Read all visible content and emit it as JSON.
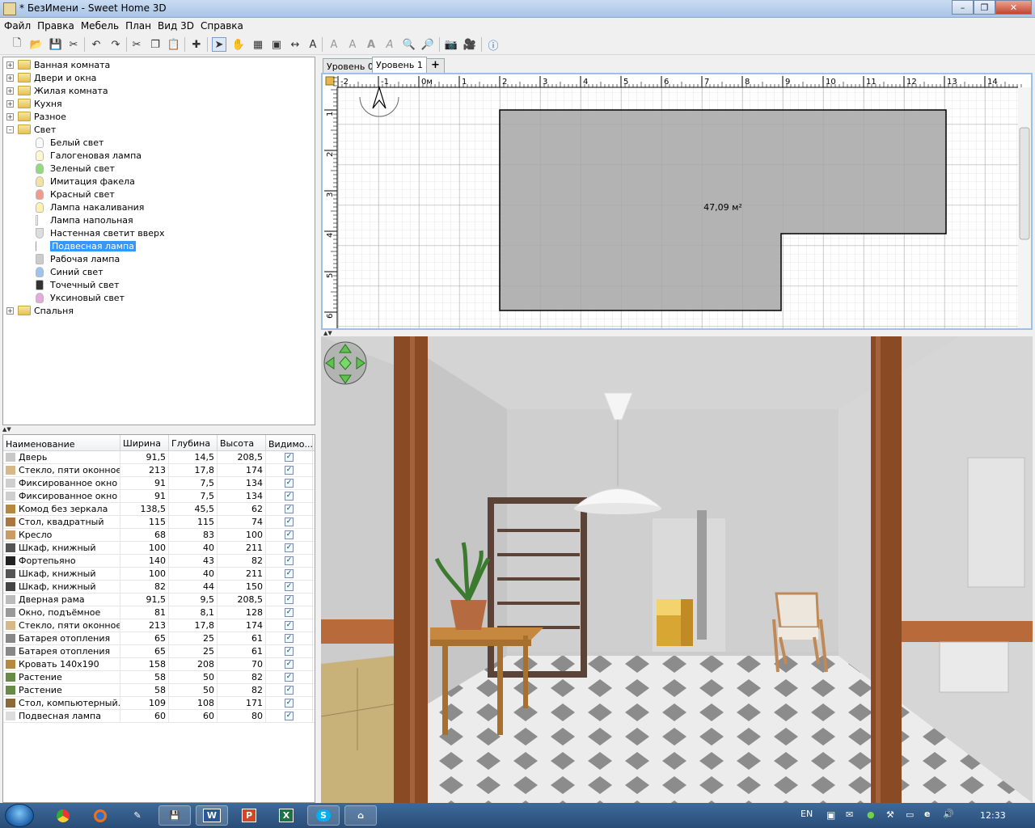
{
  "window": {
    "title": "* БезИмени - Sweet Home 3D"
  },
  "menu": [
    "Файл",
    "Правка",
    "Мебель",
    "План",
    "Вид 3D",
    "Справка"
  ],
  "toolbar": {
    "icons": [
      "new-file-icon",
      "open-folder-icon",
      "save-icon",
      "cut-scissors-icon",
      "undo-icon",
      "redo-icon",
      "cut-icon",
      "copy-icon",
      "paste-icon",
      "add-furniture-icon",
      "select-arrow-icon",
      "pan-hand-icon",
      "create-walls-icon",
      "create-rooms-icon",
      "create-dimensions-icon",
      "add-text-icon",
      "increase-text-icon",
      "decrease-text-icon",
      "bold-text-icon",
      "italic-text-icon",
      "zoom-in-icon",
      "zoom-out-icon",
      "create-photo-icon",
      "create-video-icon",
      "help-icon"
    ]
  },
  "catalog": {
    "categories": [
      {
        "label": "Ванная комната",
        "expanded": false
      },
      {
        "label": "Двери и окна",
        "expanded": false
      },
      {
        "label": "Жилая комната",
        "expanded": false
      },
      {
        "label": "Кухня",
        "expanded": false
      },
      {
        "label": "Разное",
        "expanded": false
      },
      {
        "label": "Свет",
        "expanded": true
      },
      {
        "label": "Спальня",
        "expanded": false
      }
    ],
    "light_items": [
      "Белый свет",
      "Галогеновая лампа",
      "Зеленый свет",
      "Имитация факела",
      "Красный свет",
      "Лампа накаливания",
      "Лампа напольная",
      "Настенная светит вверх",
      "Подвесная лампа",
      "Рабочая лампа",
      "Синий свет",
      "Точечный свет",
      "Уксиновый свет"
    ],
    "selected": "Подвесная лампа"
  },
  "furniture": {
    "columns": [
      "Наименование",
      "Ширина",
      "Глубина",
      "Высота",
      "Видимо..."
    ],
    "rows": [
      {
        "name": "Дверь",
        "w": "91,5",
        "d": "14,5",
        "h": "208,5",
        "visible": true
      },
      {
        "name": "Стекло, пяти оконное",
        "w": "213",
        "d": "17,8",
        "h": "174",
        "visible": true
      },
      {
        "name": "Фиксированное окно",
        "w": "91",
        "d": "7,5",
        "h": "134",
        "visible": true
      },
      {
        "name": "Фиксированное окно",
        "w": "91",
        "d": "7,5",
        "h": "134",
        "visible": true
      },
      {
        "name": "Комод без зеркала",
        "w": "138,5",
        "d": "45,5",
        "h": "62",
        "visible": true
      },
      {
        "name": "Стол, квадратный",
        "w": "115",
        "d": "115",
        "h": "74",
        "visible": true
      },
      {
        "name": "Кресло",
        "w": "68",
        "d": "83",
        "h": "100",
        "visible": true
      },
      {
        "name": "Шкаф, книжный",
        "w": "100",
        "d": "40",
        "h": "211",
        "visible": true
      },
      {
        "name": "Фортепьяно",
        "w": "140",
        "d": "43",
        "h": "82",
        "visible": true
      },
      {
        "name": "Шкаф, книжный",
        "w": "100",
        "d": "40",
        "h": "211",
        "visible": true
      },
      {
        "name": "Шкаф, книжный",
        "w": "82",
        "d": "44",
        "h": "150",
        "visible": true
      },
      {
        "name": "Дверная рама",
        "w": "91,5",
        "d": "9,5",
        "h": "208,5",
        "visible": true
      },
      {
        "name": "Окно, подъёмное",
        "w": "81",
        "d": "8,1",
        "h": "128",
        "visible": true
      },
      {
        "name": "Стекло, пяти оконное",
        "w": "213",
        "d": "17,8",
        "h": "174",
        "visible": true
      },
      {
        "name": "Батарея отопления",
        "w": "65",
        "d": "25",
        "h": "61",
        "visible": true
      },
      {
        "name": "Батарея отопления",
        "w": "65",
        "d": "25",
        "h": "61",
        "visible": true
      },
      {
        "name": "Кровать 140x190",
        "w": "158",
        "d": "208",
        "h": "70",
        "visible": true
      },
      {
        "name": "Растение",
        "w": "58",
        "d": "50",
        "h": "82",
        "visible": true
      },
      {
        "name": "Растение",
        "w": "58",
        "d": "50",
        "h": "82",
        "visible": true
      },
      {
        "name": "Стол, компьютерный...",
        "w": "109",
        "d": "108",
        "h": "171",
        "visible": true
      },
      {
        "name": "Подвесная лампа",
        "w": "60",
        "d": "60",
        "h": "80",
        "visible": true
      }
    ]
  },
  "levels": {
    "tabs": [
      "Уровень 0",
      "Уровень 1"
    ],
    "active": "Уровень 1",
    "add_label": "+"
  },
  "plan": {
    "ruler_x": [
      "-2",
      "-1",
      "0м",
      "1",
      "2",
      "3",
      "4",
      "5",
      "6",
      "7",
      "8",
      "9",
      "10",
      "11",
      "12",
      "13",
      "14"
    ],
    "ruler_y": [
      "1",
      "2",
      "3",
      "4",
      "5",
      "6"
    ],
    "room_area": "47,09 м²",
    "room_color": "#a6a6a6"
  },
  "view3d": {
    "navigator_icon": "navigation-arrows-icon"
  },
  "taskbar": {
    "apps": [
      "chrome-icon",
      "firefox-icon",
      "pen-tool-icon",
      "save-disk-icon",
      "word-icon",
      "powerpoint-icon",
      "excel-icon",
      "skype-icon",
      "sweet-home-icon"
    ],
    "app_letters": [
      "",
      "",
      "",
      "",
      "W",
      "P",
      "X",
      "S",
      ""
    ],
    "lang": "EN",
    "time": "12:33"
  },
  "colors": {
    "accent": "#3399ff",
    "plan_border": "#9cc0e8",
    "beam": "#8a4a24"
  }
}
